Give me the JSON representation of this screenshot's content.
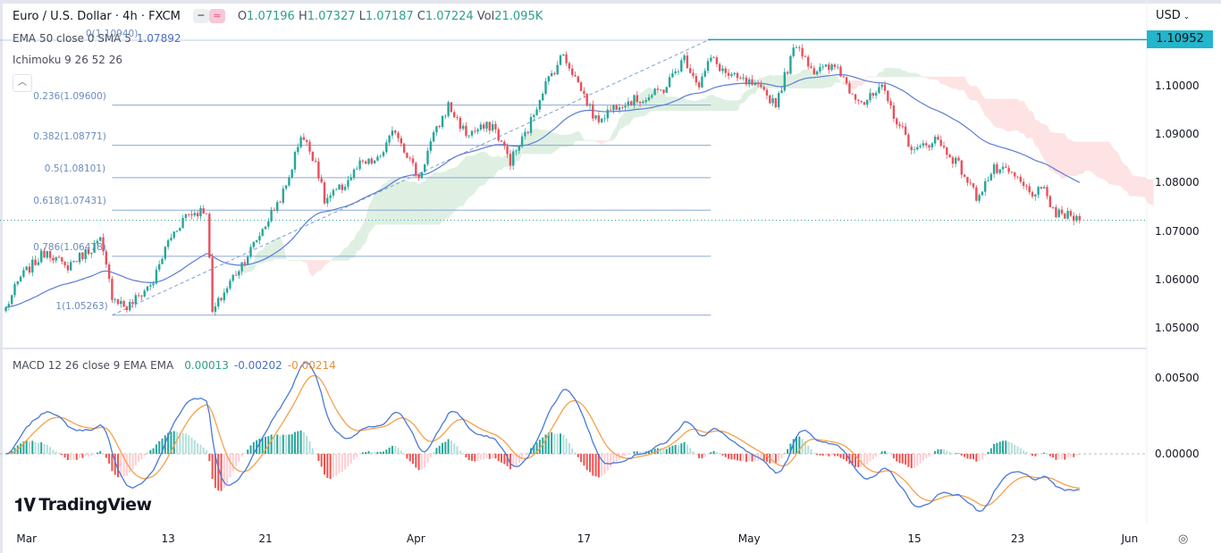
{
  "header": {
    "symbol": "Euro / U.S. Dollar · 4h · FXCM",
    "o_label": "O",
    "o": "1.07196",
    "h_label": "H",
    "h": "1.07327",
    "l_label": "L",
    "l": "1.07187",
    "c_label": "C",
    "c": "1.07224",
    "vol_label": "Vol",
    "vol": "21.095K",
    "currency": "USD",
    "collapse_icon": "chevron-up"
  },
  "indicators": {
    "ema": "EMA 50 close 0 SMA 5",
    "ema_value": "1.07892",
    "ichimoku": "Ichimoku 9 26 52 26",
    "macd": "MACD 12 26 close 9 EMA EMA",
    "macd_hist": "0.00013",
    "macd_line": "-0.00202",
    "macd_signal": "-0.00214"
  },
  "branding": "TradingView",
  "colors": {
    "up": "#26a69a",
    "down": "#e8505b",
    "ema": "#5b7bd6",
    "macd": "#4a78d8",
    "signal": "#f5a04a",
    "fib": "#7f9fd0",
    "hline": "#15a3b8",
    "cloud_up": "#dff0e3",
    "cloud_down": "#fde3e3"
  },
  "chart_data": {
    "type": "candlestick",
    "title": "Euro / U.S. Dollar · 4h · FXCM",
    "bars": 365,
    "last_close": 1.07224,
    "close_anchors": [
      [
        0,
        1.0541
      ],
      [
        5,
        1.0605
      ],
      [
        14,
        1.0661
      ],
      [
        20,
        1.0624
      ],
      [
        32,
        1.0679
      ],
      [
        36,
        1.0568
      ],
      [
        41,
        1.0541
      ],
      [
        50,
        1.0596
      ],
      [
        55,
        1.0679
      ],
      [
        61,
        1.0734
      ],
      [
        68,
        1.0744
      ],
      [
        70,
        1.0531
      ],
      [
        77,
        1.0605
      ],
      [
        83,
        1.0661
      ],
      [
        89,
        1.0725
      ],
      [
        95,
        1.079
      ],
      [
        100,
        1.09
      ],
      [
        105,
        1.0845
      ],
      [
        108,
        1.0762
      ],
      [
        114,
        1.079
      ],
      [
        120,
        1.0836
      ],
      [
        126,
        1.0845
      ],
      [
        132,
        1.091
      ],
      [
        140,
        1.0808
      ],
      [
        144,
        1.0882
      ],
      [
        150,
        1.0959
      ],
      [
        156,
        1.09
      ],
      [
        165,
        1.0919
      ],
      [
        171,
        1.0845
      ],
      [
        177,
        1.091
      ],
      [
        182,
        1.0993
      ],
      [
        189,
        1.1066
      ],
      [
        195,
        1.0993
      ],
      [
        200,
        1.0928
      ],
      [
        208,
        1.0965
      ],
      [
        217,
        1.0974
      ],
      [
        223,
        1.0993
      ],
      [
        230,
        1.1057
      ],
      [
        235,
        1.1002
      ],
      [
        239,
        1.1057
      ],
      [
        245,
        1.102
      ],
      [
        253,
        1.1002
      ],
      [
        261,
        1.0965
      ],
      [
        268,
        1.1089
      ],
      [
        274,
        1.103
      ],
      [
        282,
        1.1039
      ],
      [
        286,
        1.0993
      ],
      [
        291,
        1.0965
      ],
      [
        297,
        1.0993
      ],
      [
        302,
        1.0928
      ],
      [
        308,
        1.0863
      ],
      [
        315,
        1.0891
      ],
      [
        323,
        1.0836
      ],
      [
        329,
        1.0771
      ],
      [
        335,
        1.0827
      ],
      [
        341,
        1.0817
      ],
      [
        347,
        1.078
      ],
      [
        352,
        1.078
      ],
      [
        356,
        1.0734
      ],
      [
        361,
        1.0731
      ],
      [
        364,
        1.07224
      ]
    ],
    "price_axis": {
      "ticks": [
        "1.10000",
        "1.09000",
        "1.08000",
        "1.07000",
        "1.06000",
        "1.05000"
      ],
      "range": [
        1.0445,
        1.1135
      ]
    },
    "current_price_label": "1.10952",
    "fibonacci": [
      {
        "label": "0(1.10940)",
        "level": 1.1094
      },
      {
        "label": "0.236(1.09600)",
        "level": 1.096
      },
      {
        "label": "0.382(1.08771)",
        "level": 1.08771
      },
      {
        "label": "0.5(1.08101)",
        "level": 1.08101
      },
      {
        "label": "0.618(1.07431)",
        "level": 1.07431
      },
      {
        "label": "0.786(1.06478)",
        "level": 1.06478
      },
      {
        "label": "1(1.05263)",
        "level": 1.05263
      }
    ],
    "fib_range_bars": [
      36,
      239
    ],
    "horizontal_ray": {
      "price": 1.10952,
      "from_bar": 238
    },
    "trend_line": {
      "from": [
        36,
        1.05263
      ],
      "to": [
        238,
        1.1094
      ]
    },
    "time_axis": [
      {
        "label": "Mar",
        "bar": 7
      },
      {
        "label": "13",
        "bar": 55
      },
      {
        "label": "21",
        "bar": 88
      },
      {
        "label": "Apr",
        "bar": 139
      },
      {
        "label": "17",
        "bar": 196
      },
      {
        "label": "May",
        "bar": 252
      },
      {
        "label": "15",
        "bar": 308
      },
      {
        "label": "23",
        "bar": 343
      },
      {
        "label": "Jun",
        "bar": 381
      }
    ],
    "macd_axis": {
      "ticks": [
        "0.00500",
        "0.00000"
      ]
    },
    "macd_params": [
      12,
      26,
      9
    ],
    "ema_period": 50,
    "ichimoku_params": [
      9,
      26,
      52,
      26
    ]
  }
}
